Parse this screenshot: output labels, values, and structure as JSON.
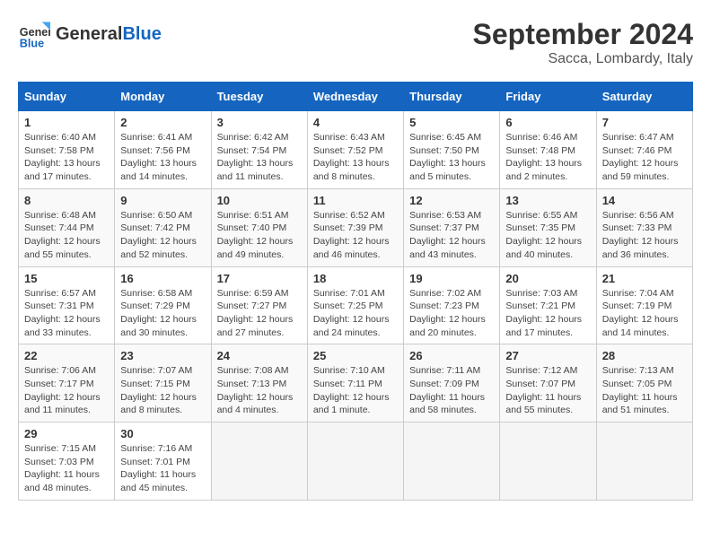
{
  "header": {
    "logo_general": "General",
    "logo_blue": "Blue",
    "month": "September 2024",
    "location": "Sacca, Lombardy, Italy"
  },
  "weekdays": [
    "Sunday",
    "Monday",
    "Tuesday",
    "Wednesday",
    "Thursday",
    "Friday",
    "Saturday"
  ],
  "weeks": [
    [
      {
        "day": 1,
        "info": "Sunrise: 6:40 AM\nSunset: 7:58 PM\nDaylight: 13 hours\nand 17 minutes."
      },
      {
        "day": 2,
        "info": "Sunrise: 6:41 AM\nSunset: 7:56 PM\nDaylight: 13 hours\nand 14 minutes."
      },
      {
        "day": 3,
        "info": "Sunrise: 6:42 AM\nSunset: 7:54 PM\nDaylight: 13 hours\nand 11 minutes."
      },
      {
        "day": 4,
        "info": "Sunrise: 6:43 AM\nSunset: 7:52 PM\nDaylight: 13 hours\nand 8 minutes."
      },
      {
        "day": 5,
        "info": "Sunrise: 6:45 AM\nSunset: 7:50 PM\nDaylight: 13 hours\nand 5 minutes."
      },
      {
        "day": 6,
        "info": "Sunrise: 6:46 AM\nSunset: 7:48 PM\nDaylight: 13 hours\nand 2 minutes."
      },
      {
        "day": 7,
        "info": "Sunrise: 6:47 AM\nSunset: 7:46 PM\nDaylight: 12 hours\nand 59 minutes."
      }
    ],
    [
      {
        "day": 8,
        "info": "Sunrise: 6:48 AM\nSunset: 7:44 PM\nDaylight: 12 hours\nand 55 minutes."
      },
      {
        "day": 9,
        "info": "Sunrise: 6:50 AM\nSunset: 7:42 PM\nDaylight: 12 hours\nand 52 minutes."
      },
      {
        "day": 10,
        "info": "Sunrise: 6:51 AM\nSunset: 7:40 PM\nDaylight: 12 hours\nand 49 minutes."
      },
      {
        "day": 11,
        "info": "Sunrise: 6:52 AM\nSunset: 7:39 PM\nDaylight: 12 hours\nand 46 minutes."
      },
      {
        "day": 12,
        "info": "Sunrise: 6:53 AM\nSunset: 7:37 PM\nDaylight: 12 hours\nand 43 minutes."
      },
      {
        "day": 13,
        "info": "Sunrise: 6:55 AM\nSunset: 7:35 PM\nDaylight: 12 hours\nand 40 minutes."
      },
      {
        "day": 14,
        "info": "Sunrise: 6:56 AM\nSunset: 7:33 PM\nDaylight: 12 hours\nand 36 minutes."
      }
    ],
    [
      {
        "day": 15,
        "info": "Sunrise: 6:57 AM\nSunset: 7:31 PM\nDaylight: 12 hours\nand 33 minutes."
      },
      {
        "day": 16,
        "info": "Sunrise: 6:58 AM\nSunset: 7:29 PM\nDaylight: 12 hours\nand 30 minutes."
      },
      {
        "day": 17,
        "info": "Sunrise: 6:59 AM\nSunset: 7:27 PM\nDaylight: 12 hours\nand 27 minutes."
      },
      {
        "day": 18,
        "info": "Sunrise: 7:01 AM\nSunset: 7:25 PM\nDaylight: 12 hours\nand 24 minutes."
      },
      {
        "day": 19,
        "info": "Sunrise: 7:02 AM\nSunset: 7:23 PM\nDaylight: 12 hours\nand 20 minutes."
      },
      {
        "day": 20,
        "info": "Sunrise: 7:03 AM\nSunset: 7:21 PM\nDaylight: 12 hours\nand 17 minutes."
      },
      {
        "day": 21,
        "info": "Sunrise: 7:04 AM\nSunset: 7:19 PM\nDaylight: 12 hours\nand 14 minutes."
      }
    ],
    [
      {
        "day": 22,
        "info": "Sunrise: 7:06 AM\nSunset: 7:17 PM\nDaylight: 12 hours\nand 11 minutes."
      },
      {
        "day": 23,
        "info": "Sunrise: 7:07 AM\nSunset: 7:15 PM\nDaylight: 12 hours\nand 8 minutes."
      },
      {
        "day": 24,
        "info": "Sunrise: 7:08 AM\nSunset: 7:13 PM\nDaylight: 12 hours\nand 4 minutes."
      },
      {
        "day": 25,
        "info": "Sunrise: 7:10 AM\nSunset: 7:11 PM\nDaylight: 12 hours\nand 1 minute."
      },
      {
        "day": 26,
        "info": "Sunrise: 7:11 AM\nSunset: 7:09 PM\nDaylight: 11 hours\nand 58 minutes."
      },
      {
        "day": 27,
        "info": "Sunrise: 7:12 AM\nSunset: 7:07 PM\nDaylight: 11 hours\nand 55 minutes."
      },
      {
        "day": 28,
        "info": "Sunrise: 7:13 AM\nSunset: 7:05 PM\nDaylight: 11 hours\nand 51 minutes."
      }
    ],
    [
      {
        "day": 29,
        "info": "Sunrise: 7:15 AM\nSunset: 7:03 PM\nDaylight: 11 hours\nand 48 minutes."
      },
      {
        "day": 30,
        "info": "Sunrise: 7:16 AM\nSunset: 7:01 PM\nDaylight: 11 hours\nand 45 minutes."
      },
      {
        "day": null,
        "info": ""
      },
      {
        "day": null,
        "info": ""
      },
      {
        "day": null,
        "info": ""
      },
      {
        "day": null,
        "info": ""
      },
      {
        "day": null,
        "info": ""
      }
    ]
  ]
}
